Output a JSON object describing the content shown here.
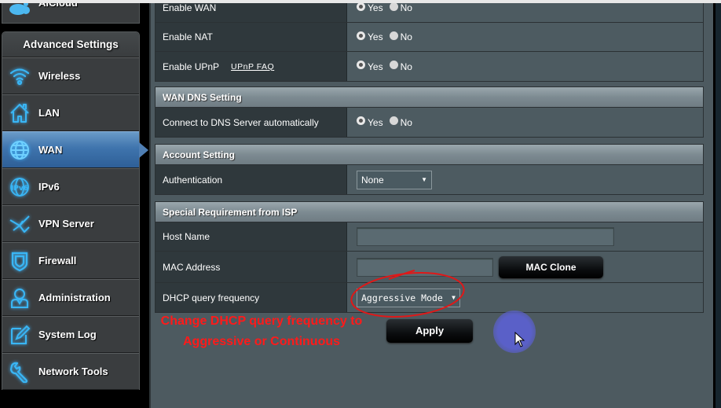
{
  "sidebar": {
    "top_item": {
      "label": "AiCloud",
      "icon": "aicloud-icon"
    },
    "section_title": "Advanced Settings",
    "items": [
      {
        "label": "Wireless",
        "icon": "wifi-icon",
        "active": false
      },
      {
        "label": "LAN",
        "icon": "home-icon",
        "active": false
      },
      {
        "label": "WAN",
        "icon": "globe-icon",
        "active": true
      },
      {
        "label": "IPv6",
        "icon": "ipv6-globe-icon",
        "active": false
      },
      {
        "label": "VPN Server",
        "icon": "vpn-icon",
        "active": false
      },
      {
        "label": "Firewall",
        "icon": "shield-icon",
        "active": false
      },
      {
        "label": "Administration",
        "icon": "user-icon",
        "active": false
      },
      {
        "label": "System Log",
        "icon": "log-edit-icon",
        "active": false
      },
      {
        "label": "Network Tools",
        "icon": "wrench-icon",
        "active": false
      }
    ]
  },
  "radio_labels": {
    "yes": "Yes",
    "no": "No"
  },
  "basic": {
    "enable_wan": {
      "label": "Enable WAN",
      "value": "Yes"
    },
    "enable_nat": {
      "label": "Enable NAT",
      "value": "Yes"
    },
    "enable_upnp": {
      "label": "Enable UPnP",
      "link": "UPnP  FAQ",
      "value": "Yes"
    }
  },
  "wan_dns": {
    "title": "WAN DNS Setting",
    "connect_dns_auto": {
      "label": "Connect to DNS Server automatically",
      "value": "Yes"
    }
  },
  "account": {
    "title": "Account Setting",
    "authentication": {
      "label": "Authentication",
      "value": "None"
    }
  },
  "isp": {
    "title": "Special Requirement from ISP",
    "host_name": {
      "label": "Host Name",
      "value": ""
    },
    "mac_address": {
      "label": "MAC Address",
      "value": "",
      "button": "MAC Clone"
    },
    "dhcp_query": {
      "label": "DHCP query frequency",
      "value": "Aggressive Mode"
    }
  },
  "apply_button": "Apply",
  "annotation": {
    "line1": "Change DHCP query frequency to",
    "line2": "Aggressive or Continuous",
    "color": "#ff1a1a"
  }
}
